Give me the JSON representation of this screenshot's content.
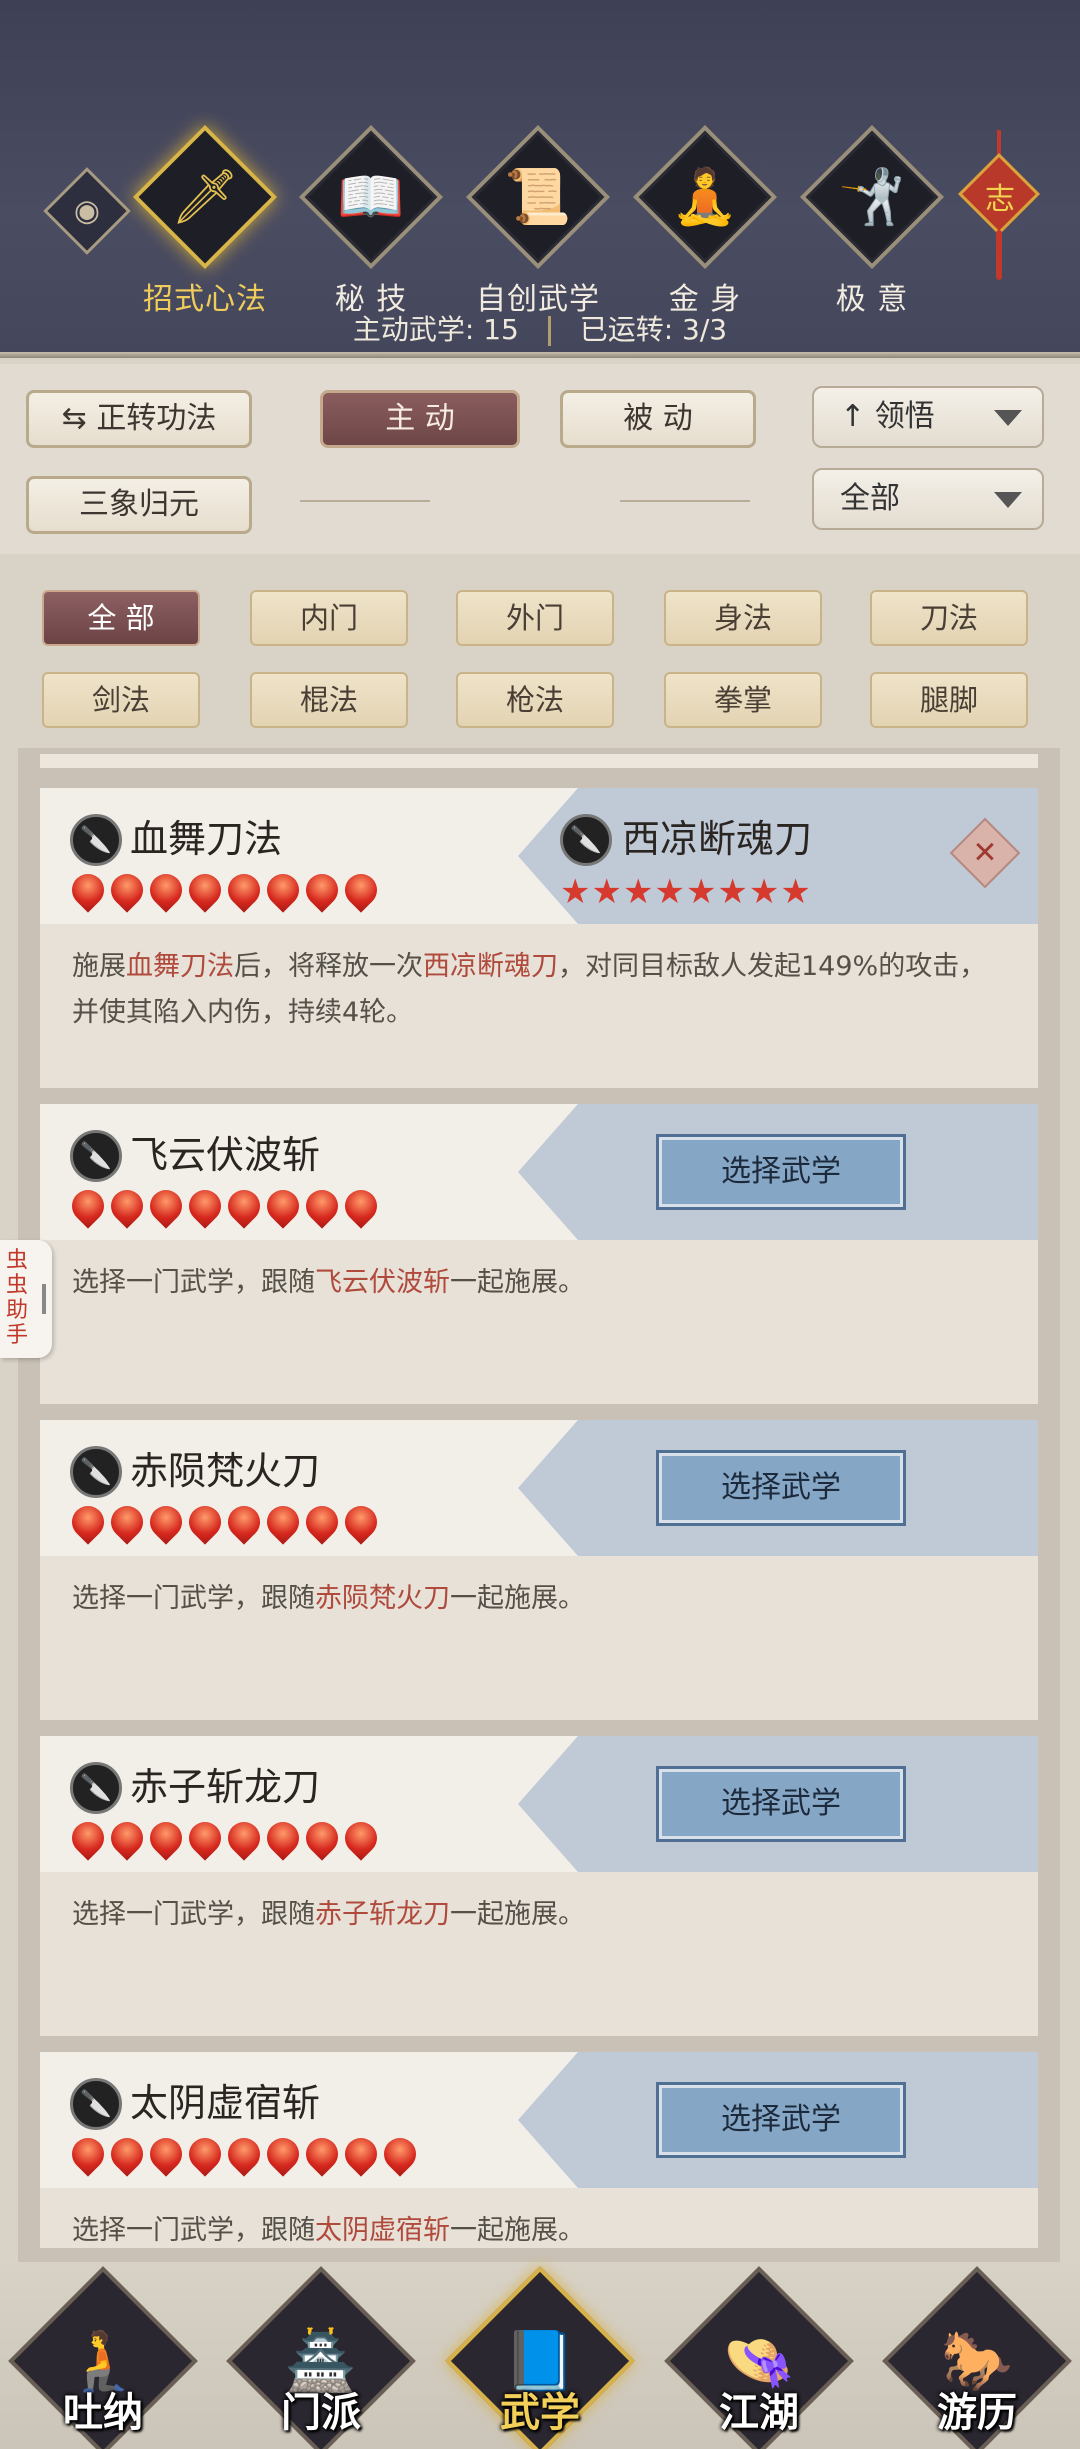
{
  "header": {
    "tabs": [
      {
        "label": "招式心法",
        "icon": "sword-icon",
        "glyph": "🗡",
        "active": true
      },
      {
        "label": "秘 技",
        "icon": "book-icon",
        "glyph": "📖",
        "active": false
      },
      {
        "label": "自创武学",
        "icon": "scroll-icon",
        "glyph": "📜",
        "active": false
      },
      {
        "label": "金 身",
        "icon": "meditation-icon",
        "glyph": "🧘",
        "active": false
      },
      {
        "label": "极 意",
        "icon": "martial-pose-icon",
        "glyph": "🤺",
        "active": false
      }
    ],
    "knot_char": "志",
    "status": {
      "active_label": "主动武学: 15",
      "running_label": "已运转: 3/3"
    }
  },
  "controls": {
    "rotate_label": "正转功法",
    "mode_active": "主 动",
    "mode_passive": "被 动",
    "sort_value": "领悟",
    "filter_value": "全部",
    "sanxiang_label": "三象归元"
  },
  "filters": [
    "全 部",
    "内门",
    "外门",
    "身法",
    "刀法",
    "剑法",
    "棍法",
    "枪法",
    "拳掌",
    "腿脚"
  ],
  "cards": [
    {
      "name": "血舞刀法",
      "level": 8,
      "linked": {
        "name": "西凉断魂刀",
        "stars": 8
      },
      "desc": {
        "pre": "施展",
        "hl1": "血舞刀法",
        "mid": "后，将释放一次",
        "hl2": "西凉断魂刀",
        "post": "，对同目标敌人发起149%的攻击，并使其陷入内伤，持续4轮。"
      }
    },
    {
      "name": "飞云伏波斩",
      "level": 8,
      "button": "选择武学",
      "desc": {
        "pre": "选择一门武学，跟随",
        "hl1": "飞云伏波斩",
        "post": "一起施展。"
      }
    },
    {
      "name": "赤陨梵火刀",
      "level": 8,
      "button": "选择武学",
      "desc": {
        "pre": "选择一门武学，跟随",
        "hl1": "赤陨梵火刀",
        "post": "一起施展。"
      }
    },
    {
      "name": "赤子斩龙刀",
      "level": 8,
      "button": "选择武学",
      "desc": {
        "pre": "选择一门武学，跟随",
        "hl1": "赤子斩龙刀",
        "post": "一起施展。"
      }
    },
    {
      "name": "太阴虚宿斩",
      "level": 9,
      "button": "选择武学",
      "desc": {
        "pre": "选择一门武学，跟随",
        "hl1": "太阴虚宿斩",
        "post": "一起施展。"
      }
    }
  ],
  "helper_label": "虫虫助手",
  "bottom_nav": [
    {
      "label": "吐纳",
      "icon": "monk-icon",
      "glyph": "🧎",
      "active": false
    },
    {
      "label": "门派",
      "icon": "clan-banner-icon",
      "glyph": "🏯",
      "active": false
    },
    {
      "label": "武学",
      "icon": "martial-book-icon",
      "glyph": "📘",
      "active": true
    },
    {
      "label": "江湖",
      "icon": "straw-hat-icon",
      "glyph": "👒",
      "active": false
    },
    {
      "label": "游历",
      "icon": "horse-icon",
      "glyph": "🐎",
      "active": false
    }
  ]
}
